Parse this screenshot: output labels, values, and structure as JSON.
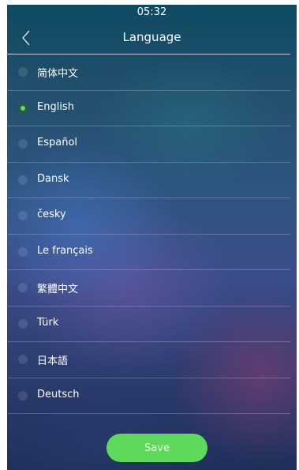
{
  "status_bar": {
    "time": "05:32"
  },
  "header": {
    "title": "Language",
    "back_icon": "chevron-left-icon"
  },
  "languages": [
    {
      "label": "简体中文",
      "selected": false
    },
    {
      "label": "English",
      "selected": true
    },
    {
      "label": "Español",
      "selected": false
    },
    {
      "label": "Dansk",
      "selected": false
    },
    {
      "label": "česky",
      "selected": false
    },
    {
      "label": "Le français",
      "selected": false
    },
    {
      "label": "繁體中文",
      "selected": false
    },
    {
      "label": "Türk",
      "selected": false
    },
    {
      "label": "日本語",
      "selected": false
    },
    {
      "label": "Deutsch",
      "selected": false
    }
  ],
  "save_button": {
    "label": "Save"
  },
  "colors": {
    "accent": "#5fd95c",
    "text": "#ffffff"
  }
}
